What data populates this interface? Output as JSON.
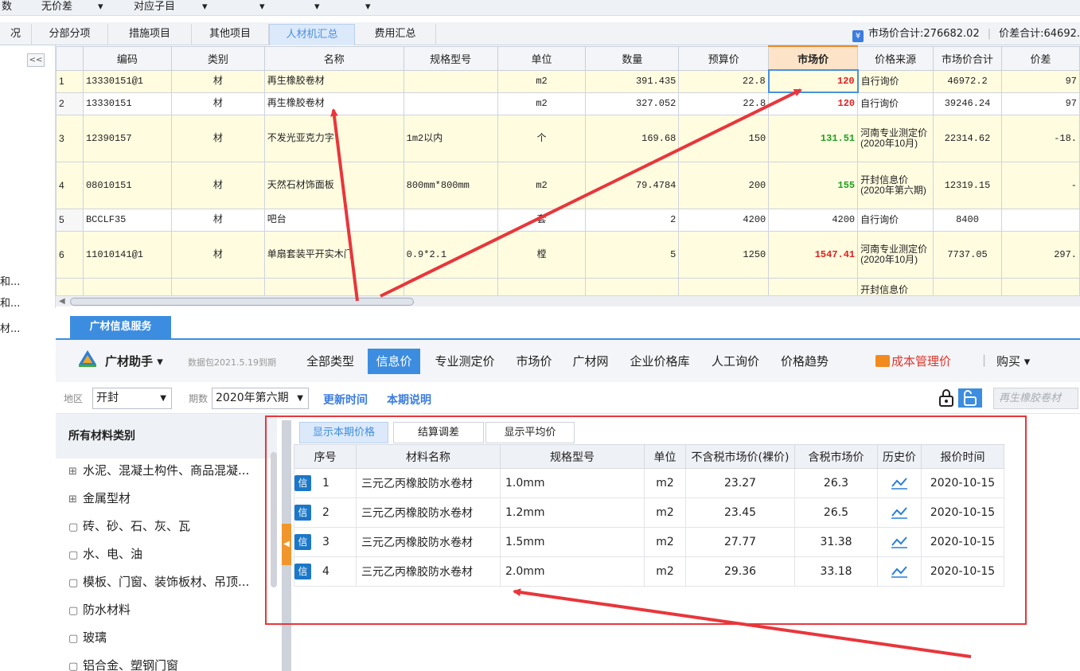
{
  "toolbar": [
    "数",
    "无价差",
    "▾",
    "对应子目",
    "▾",
    "▾",
    "▾",
    "▾"
  ],
  "tabs": [
    {
      "label": "况",
      "active": false
    },
    {
      "label": "分部分项",
      "active": false
    },
    {
      "label": "措施项目",
      "active": false
    },
    {
      "label": "其他项目",
      "active": false
    },
    {
      "label": "人材机汇总",
      "active": true
    },
    {
      "label": "费用汇总",
      "active": false
    }
  ],
  "totals": {
    "market_total": "市场价合计:276682.02",
    "diff_total": "价差合计:64692."
  },
  "leftnav": {
    "collapse": "<<",
    "items": [
      "和...",
      "和...",
      "材..."
    ]
  },
  "grid": {
    "columns": [
      "",
      "编码",
      "类别",
      "名称",
      "规格型号",
      "单位",
      "数量",
      "预算价",
      "市场价",
      "价格来源",
      "市场价合计",
      "价差"
    ],
    "rows": [
      {
        "n": "1",
        "code": "13330151@1",
        "type": "材",
        "name": "再生橡胶卷材",
        "spec": "",
        "unit": "m2",
        "qty": "391.435",
        "budget": "22.8",
        "market": "120",
        "market_color": "red",
        "source": "自行询价",
        "total": "46972.2",
        "diff": "97",
        "yellow": true
      },
      {
        "n": "2",
        "code": "13330151",
        "type": "材",
        "name": "再生橡胶卷材",
        "spec": "",
        "unit": "m2",
        "qty": "327.052",
        "budget": "22.8",
        "market": "120",
        "market_color": "red",
        "source": "自行询价",
        "total": "39246.24",
        "diff": "97",
        "yellow": false
      },
      {
        "n": "3",
        "code": "12390157",
        "type": "材",
        "name": "不发光亚克力字",
        "spec": "1m2以内",
        "unit": "个",
        "qty": "169.68",
        "budget": "150",
        "market": "131.51",
        "market_color": "green",
        "source": "河南专业测定价(2020年10月)",
        "total": "22314.62",
        "diff": "-18.",
        "yellow": true
      },
      {
        "n": "4",
        "code": "08010151",
        "type": "材",
        "name": "天然石材饰面板",
        "spec": "800mm*800mm",
        "unit": "m2",
        "qty": "79.4784",
        "budget": "200",
        "market": "155",
        "market_color": "green",
        "source": "开封信息价(2020年第六期)",
        "total": "12319.15",
        "diff": "-",
        "yellow": true
      },
      {
        "n": "5",
        "code": "BCCLF35",
        "type": "材",
        "name": "吧台",
        "spec": "",
        "unit": "套",
        "qty": "2",
        "budget": "4200",
        "market": "4200",
        "market_color": "normal",
        "source": "自行询价",
        "total": "8400",
        "diff": "",
        "yellow": false
      },
      {
        "n": "6",
        "code": "11010141@1",
        "type": "材",
        "name": "单扇套装平开实木门",
        "spec": "0.9*2.1",
        "unit": "樘",
        "qty": "5",
        "budget": "1250",
        "market": "1547.41",
        "market_color": "red",
        "source": "河南专业测定价(2020年10月)",
        "total": "7737.05",
        "diff": "297.",
        "yellow": true
      },
      {
        "n": "",
        "code": "",
        "type": "",
        "name": "",
        "spec": "",
        "unit": "",
        "qty": "",
        "budget": "",
        "market": "",
        "market_color": "normal",
        "source": "开封信息价",
        "total": "",
        "diff": "",
        "yellow": true
      }
    ]
  },
  "pane_tab": "广材信息服务",
  "guangcai": {
    "assistant": "广材助手 ▾",
    "package": "数据包2021.5.19到期",
    "nav": [
      {
        "label": "全部类型",
        "active": false
      },
      {
        "label": "信息价",
        "active": true
      },
      {
        "label": "专业测定价",
        "active": false
      },
      {
        "label": "市场价",
        "active": false
      },
      {
        "label": "广材网",
        "active": false
      },
      {
        "label": "企业价格库",
        "active": false
      },
      {
        "label": "人工询价",
        "active": false
      },
      {
        "label": "价格趋势",
        "active": false
      }
    ],
    "cost_mgmt": "成本管理价",
    "buy": "购买 ▾",
    "sep": "|"
  },
  "filters": {
    "region_label": "地区",
    "region_value": "开封",
    "period_label": "期数",
    "period_value": "2020年第六期",
    "update_time": "更新时间",
    "period_note": "本期说明",
    "search_placeholder": "再生橡胶卷材"
  },
  "categories": {
    "header": "所有材料类别",
    "items": [
      {
        "icon": "⊞",
        "label": "水泥、混凝土构件、商品混凝..."
      },
      {
        "icon": "⊞",
        "label": "金属型材"
      },
      {
        "icon": "▢",
        "label": "砖、砂、石、灰、瓦"
      },
      {
        "icon": "▢",
        "label": "水、电、油"
      },
      {
        "icon": "▢",
        "label": "模板、门窗、装饰板材、吊顶..."
      },
      {
        "icon": "▢",
        "label": "防水材料"
      },
      {
        "icon": "▢",
        "label": "玻璃"
      },
      {
        "icon": "▢",
        "label": "铝合金、塑钢门窗"
      }
    ]
  },
  "subtabs": [
    {
      "label": "显示本期价格",
      "active": true
    },
    {
      "label": "结算调差",
      "active": false
    },
    {
      "label": "显示平均价",
      "active": false
    }
  ],
  "price_table": {
    "columns": [
      "序号",
      "材料名称",
      "规格型号",
      "单位",
      "不含税市场价(裸价)",
      "含税市场价",
      "历史价",
      "报价时间"
    ],
    "badge": "信",
    "rows": [
      {
        "n": "1",
        "name": "三元乙丙橡胶防水卷材",
        "spec": "1.0mm",
        "unit": "m2",
        "net": "23.27",
        "gross": "26.3",
        "date": "2020-10-15"
      },
      {
        "n": "2",
        "name": "三元乙丙橡胶防水卷材",
        "spec": "1.2mm",
        "unit": "m2",
        "net": "23.45",
        "gross": "26.5",
        "date": "2020-10-15"
      },
      {
        "n": "3",
        "name": "三元乙丙橡胶防水卷材",
        "spec": "1.5mm",
        "unit": "m2",
        "net": "27.77",
        "gross": "31.38",
        "date": "2020-10-15"
      },
      {
        "n": "4",
        "name": "三元乙丙橡胶防水卷材",
        "spec": "2.0mm",
        "unit": "m2",
        "net": "29.36",
        "gross": "33.18",
        "date": "2020-10-15"
      }
    ]
  },
  "colors": {
    "accent": "#3c8de0",
    "price_red": "#e02020",
    "price_green": "#22a022",
    "annotation_red": "#e8363b",
    "row_yellow": "#fffce0"
  }
}
